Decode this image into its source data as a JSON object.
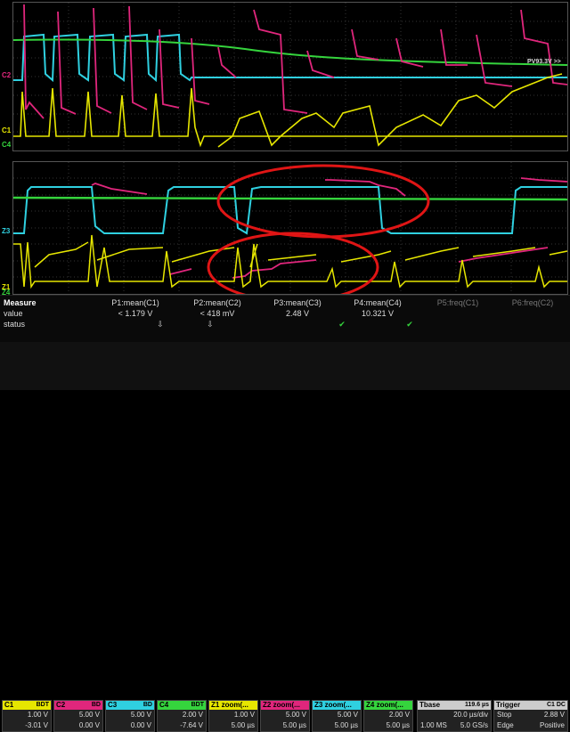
{
  "markers": {
    "c2": "C2",
    "c1": "C1",
    "c4": "C4",
    "z3": "Z3",
    "z1": "Z1",
    "z4": "Z4",
    "pvlabel": "PV93.3V >>"
  },
  "measure": {
    "title": "Measure",
    "row_value": "value",
    "row_status": "status",
    "params": [
      {
        "name": "P1:mean(C1)",
        "value": "< 1.179 V",
        "status": "⇩"
      },
      {
        "name": "P2:mean(C2)",
        "value": "< 418 mV",
        "status": "⇩"
      },
      {
        "name": "P3:mean(C3)",
        "value": "2.48 V",
        "status": "✔"
      },
      {
        "name": "P4:mean(C4)",
        "value": "10.321 V",
        "status": "✔"
      },
      {
        "name": "P5:freq(C1)",
        "value": "",
        "status": ""
      },
      {
        "name": "P6:freq(C2)",
        "value": "",
        "status": ""
      }
    ]
  },
  "channels": [
    {
      "name": "C1",
      "badge": "BDT",
      "scale": "1.00 V",
      "offset": "-3.01 V",
      "color": "#e6e600"
    },
    {
      "name": "C2",
      "badge": "BD",
      "scale": "5.00 V",
      "offset": "0.00 V",
      "color": "#e0267c"
    },
    {
      "name": "C3",
      "badge": "BD",
      "scale": "5.00 V",
      "offset": "0.00 V",
      "color": "#2fd0e0"
    },
    {
      "name": "C4",
      "badge": "BDT",
      "scale": "2.00 V",
      "offset": "-7.64 V",
      "color": "#35d43d"
    },
    {
      "name": "Z1",
      "badge": "zoom(...",
      "scale": "1.00 V",
      "offset": "5.00 µs",
      "color": "#e6e600"
    },
    {
      "name": "Z2",
      "badge": "zoom(...",
      "scale": "5.00 V",
      "offset": "5.00 µs",
      "color": "#e0267c"
    },
    {
      "name": "Z3",
      "badge": "zoom(...",
      "scale": "5.00 V",
      "offset": "5.00 µs",
      "color": "#2fd0e0"
    },
    {
      "name": "Z4",
      "badge": "zoom(...",
      "scale": "2.00 V",
      "offset": "5.00 µs",
      "color": "#35d43d"
    }
  ],
  "timebase": {
    "label": "Tbase",
    "delay": "119.6 µs",
    "per_div": "20.0 µs/div",
    "samples": "1.00 MS",
    "rate": "5.0 GS/s"
  },
  "trigger": {
    "label": "Trigger",
    "badge": "C1 DC",
    "mode": "Stop",
    "level": "2.88 V",
    "type": "Edge",
    "slope": "Positive"
  },
  "colors": {
    "c1": "#e6e600",
    "c2": "#e0267c",
    "c3": "#2fd0e0",
    "c4": "#35d43d",
    "annotation": "#e01515"
  }
}
